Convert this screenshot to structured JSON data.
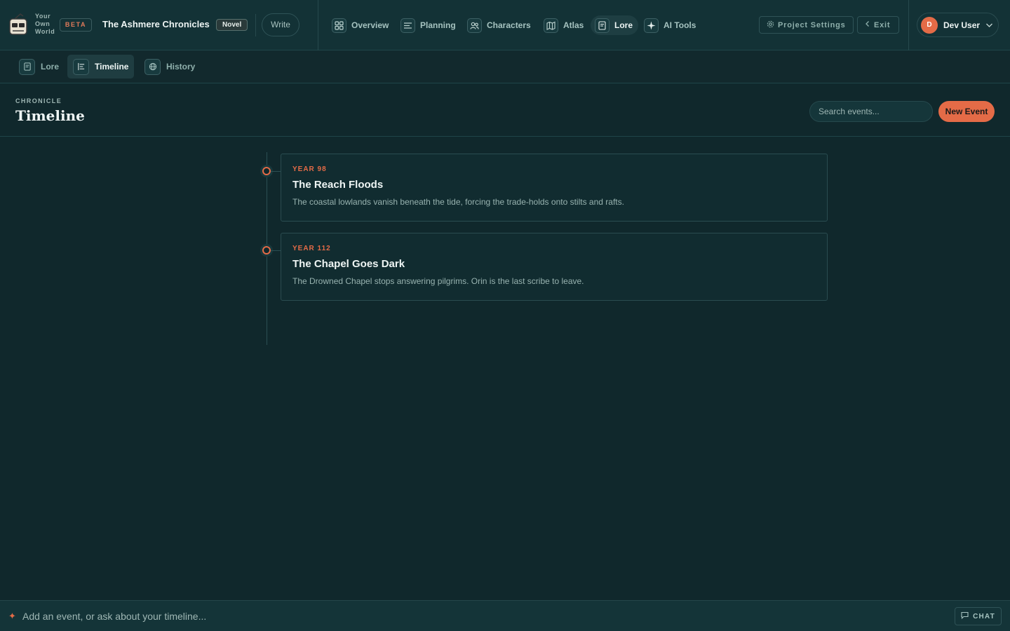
{
  "brand": {
    "lines": [
      "Your",
      "Own",
      "World"
    ],
    "badge": "BETA"
  },
  "project": {
    "title": "The Ashmere Chronicles",
    "type_badge": "Novel"
  },
  "header": {
    "write_label": "Write",
    "nav": [
      {
        "label": "Overview",
        "icon": "grid-icon",
        "active": false
      },
      {
        "label": "Planning",
        "icon": "list-icon",
        "active": false
      },
      {
        "label": "Characters",
        "icon": "users-icon",
        "active": false
      },
      {
        "label": "Atlas",
        "icon": "map-icon",
        "active": false
      },
      {
        "label": "Lore",
        "icon": "book-icon",
        "active": true
      },
      {
        "label": "AI Tools",
        "icon": "sparkle-icon",
        "active": false
      }
    ],
    "project_settings_label": "Project Settings",
    "exit_label": "Exit",
    "user": {
      "initial": "D",
      "name": "Dev User"
    }
  },
  "subtabs": [
    {
      "label": "Lore",
      "icon": "book-icon",
      "active": false
    },
    {
      "label": "Timeline",
      "icon": "timeline-icon",
      "active": true
    },
    {
      "label": "History",
      "icon": "globe-icon",
      "active": false
    }
  ],
  "page": {
    "eyebrow": "CHRONICLE",
    "title": "Timeline",
    "search_placeholder": "Search events...",
    "new_event_label": "New Event"
  },
  "events": [
    {
      "year": "YEAR 98",
      "title": "The Reach Floods",
      "description": "The coastal lowlands vanish beneath the tide, forcing the trade-holds onto stilts and rafts."
    },
    {
      "year": "YEAR 112",
      "title": "The Chapel Goes Dark",
      "description": "The Drowned Chapel stops answering pilgrims. Orin is the last scribe to leave."
    }
  ],
  "chat": {
    "placeholder": "Add an event, or ask about your timeline...",
    "button_label": "CHAT"
  },
  "colors": {
    "accent": "#e46b47",
    "background": "#10282c",
    "header": "#133236"
  }
}
